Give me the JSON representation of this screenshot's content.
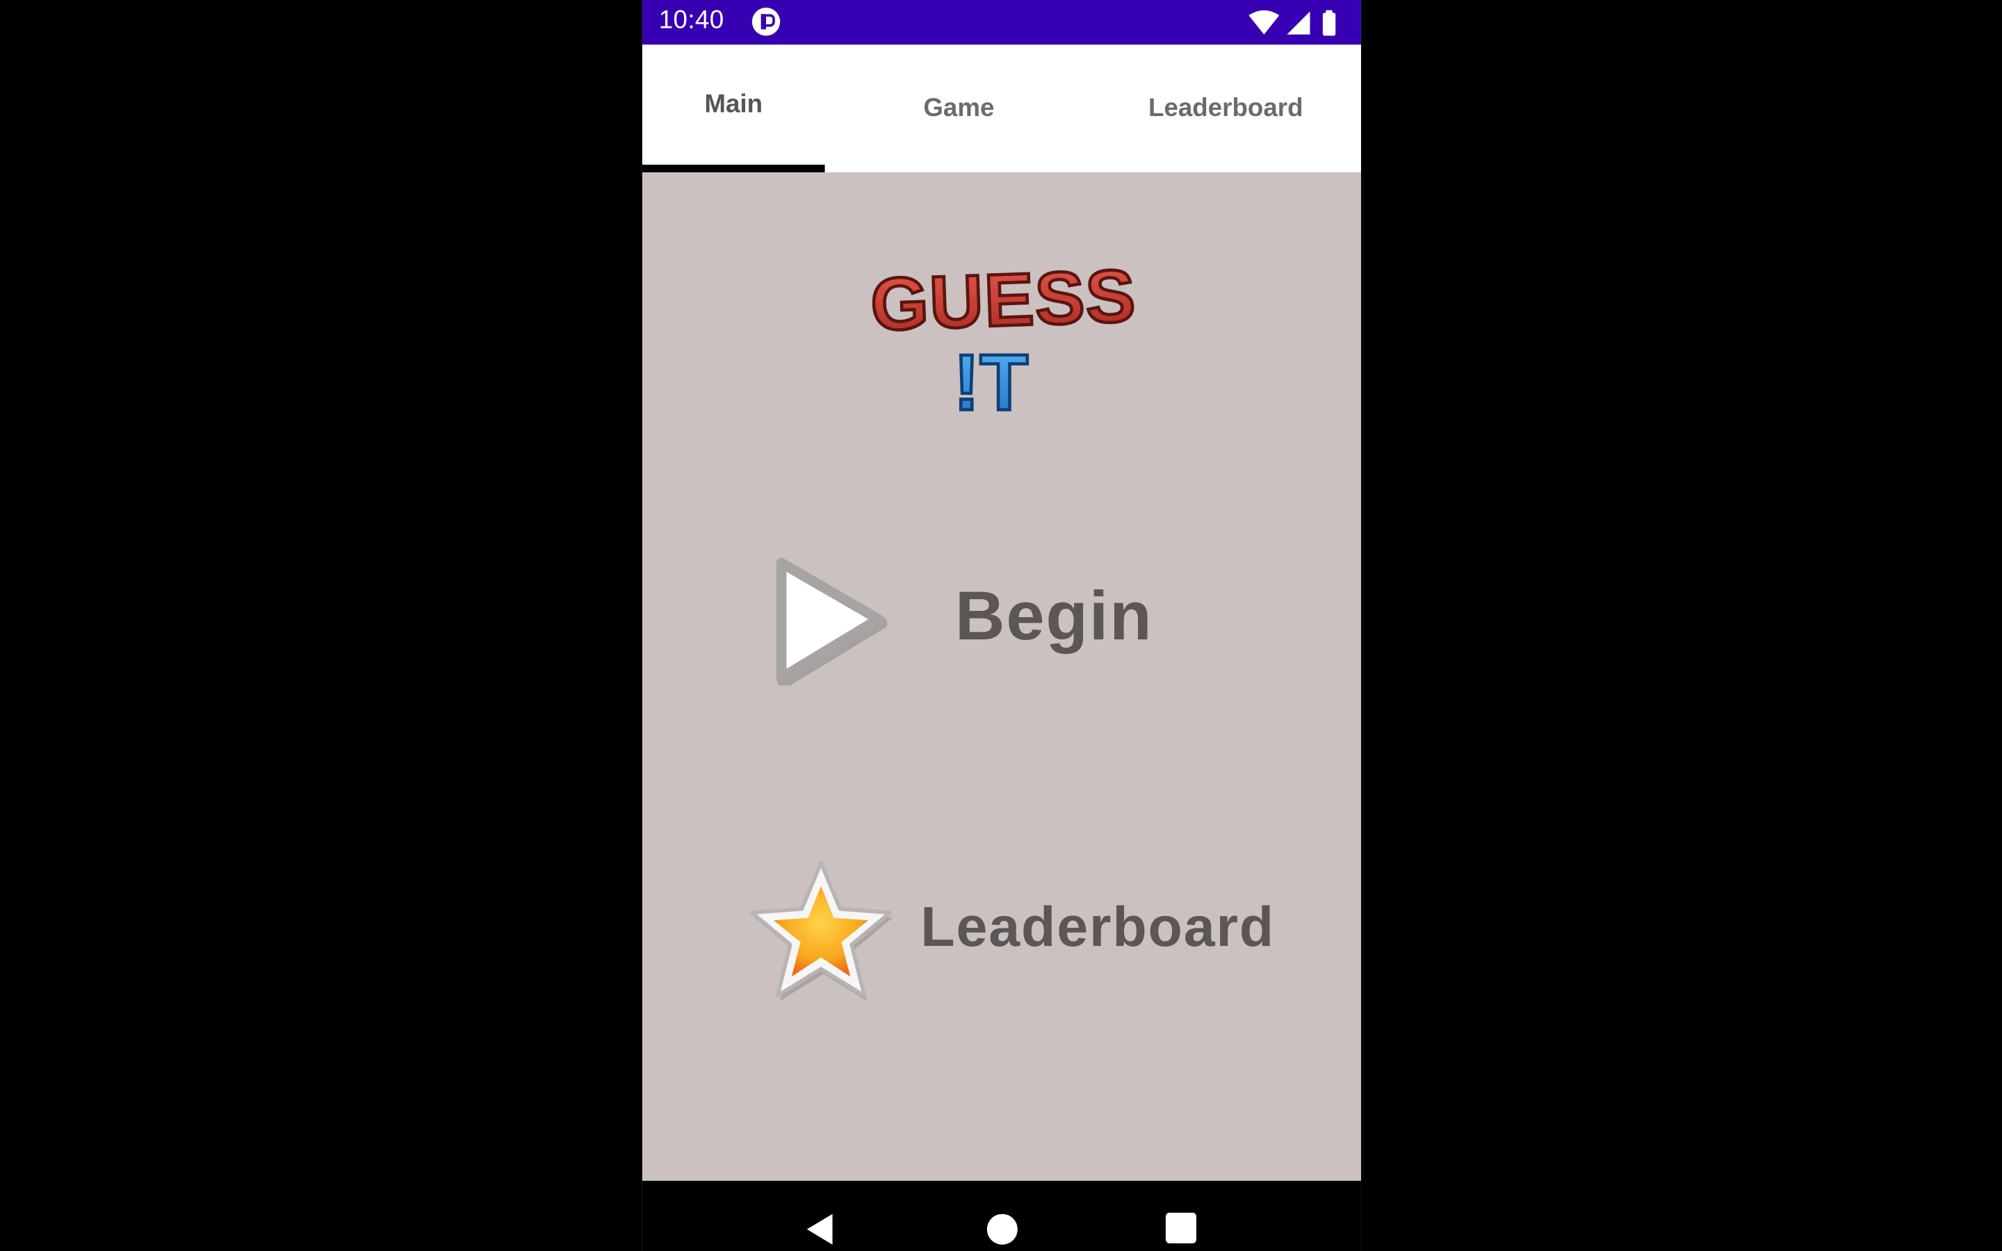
{
  "status_bar": {
    "time": "10:40",
    "icons": [
      "notification-icon",
      "wifi-icon",
      "signal-icon",
      "battery-icon"
    ]
  },
  "tabs": [
    {
      "label": "Main",
      "selected": true
    },
    {
      "label": "Game",
      "selected": false
    },
    {
      "label": "Leaderboard",
      "selected": false
    }
  ],
  "logo": {
    "line1": "GUESS",
    "line2": "!T"
  },
  "menu": {
    "begin_label": "Begin",
    "leaderboard_label": "Leaderboard"
  },
  "colors": {
    "status_bar": "#3700b3",
    "content_bg": "#cbc1c1",
    "logo_red": "#d9453a",
    "logo_blue": "#2f8fe0",
    "menu_text": "#5c5656"
  }
}
